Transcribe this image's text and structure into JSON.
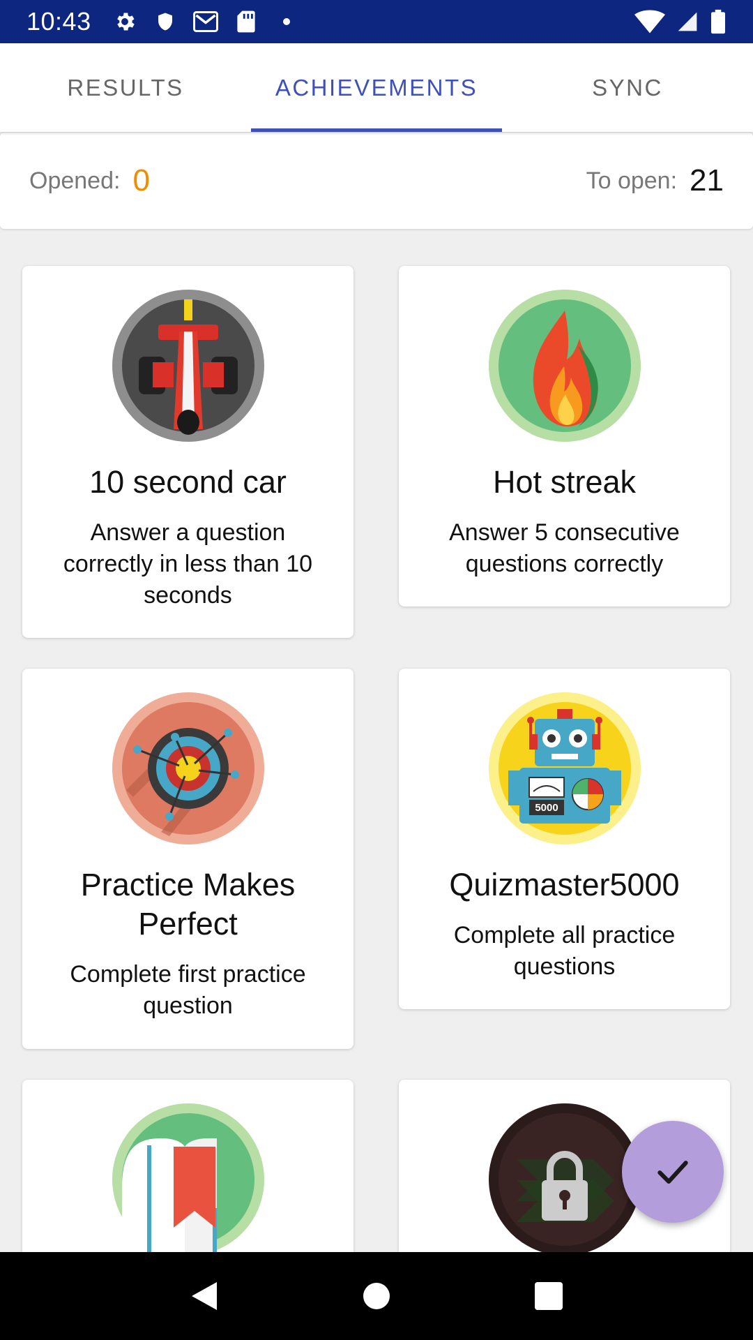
{
  "status_bar": {
    "time": "10:43",
    "icons_left": [
      "settings-icon",
      "shield-icon",
      "gmail-icon",
      "sd-card-icon",
      "dot-icon"
    ],
    "icons_right": [
      "wifi-icon",
      "signal-icon",
      "battery-icon"
    ]
  },
  "tabs": [
    {
      "label": "RESULTS",
      "active": false
    },
    {
      "label": "ACHIEVEMENTS",
      "active": true
    },
    {
      "label": "SYNC",
      "active": false
    }
  ],
  "summary": {
    "opened_label": "Opened:",
    "opened_value": "0",
    "to_open_label": "To open:",
    "to_open_value": "21"
  },
  "achievements": [
    {
      "title": "10 second car",
      "description": "Answer a question correctly in less than 10 seconds",
      "icon": "race-car-icon"
    },
    {
      "title": "Hot streak",
      "description": "Answer 5 consecutive questions correctly",
      "icon": "flame-icon"
    },
    {
      "title": "Practice Makes Perfect",
      "description": "Complete first practice question",
      "icon": "target-icon"
    },
    {
      "title": "Quizmaster5000",
      "description": "Complete all practice questions",
      "icon": "robot-icon",
      "badge_text": "5000"
    },
    {
      "title": "",
      "description": "",
      "icon": "book-icon"
    },
    {
      "title": "",
      "description": "",
      "icon": "lock-icon"
    }
  ],
  "fab": {
    "icon": "check-icon"
  },
  "nav_bar": {
    "icons": [
      "back-icon",
      "home-icon",
      "recents-icon"
    ]
  },
  "colors": {
    "status_bar": "#0d2680",
    "accent": "#3f51b5",
    "opened_value": "#f08c00",
    "fab": "#b39ddb"
  }
}
